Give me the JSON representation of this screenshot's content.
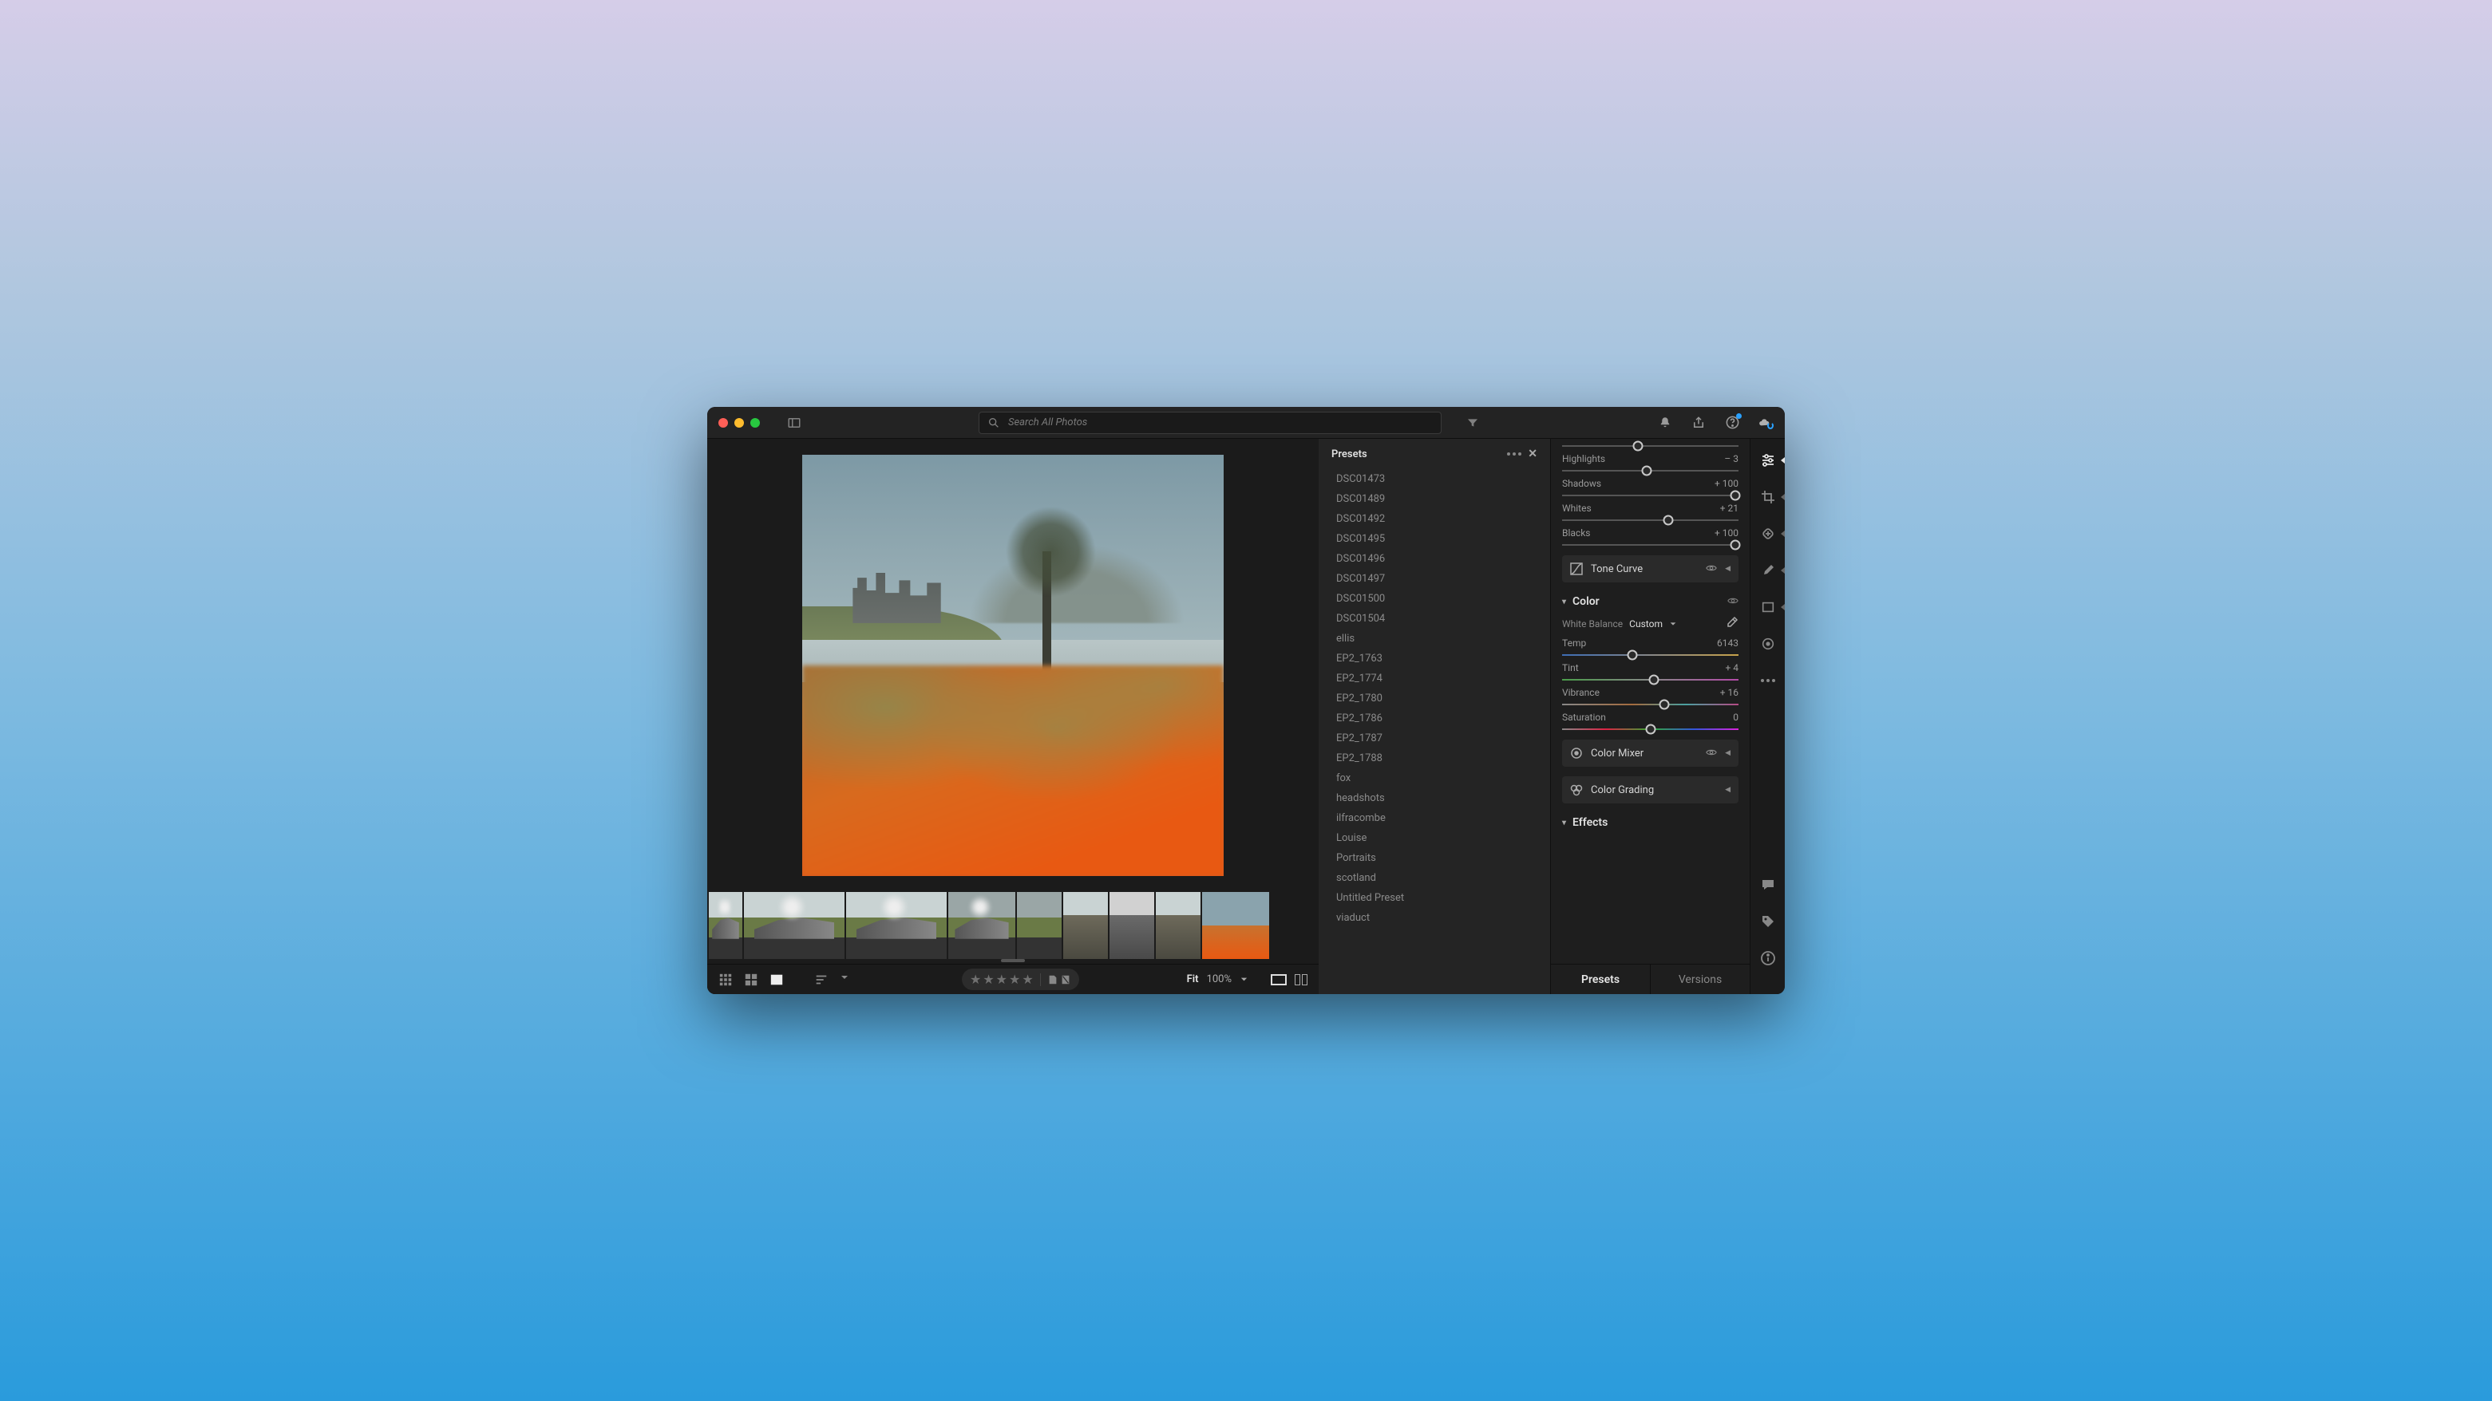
{
  "search": {
    "placeholder": "Search All Photos"
  },
  "presets": {
    "title": "Presets",
    "items": [
      "DSC01473",
      "DSC01489",
      "DSC01492",
      "DSC01495",
      "DSC01496",
      "DSC01497",
      "DSC01500",
      "DSC01504",
      "ellis",
      "EP2_1763",
      "EP2_1774",
      "EP2_1780",
      "EP2_1786",
      "EP2_1787",
      "EP2_1788",
      "fox",
      "headshots",
      "ilfracombe",
      "Louise",
      "Portraits",
      "scotland",
      "Untitled Preset",
      "viaduct"
    ]
  },
  "light": {
    "highlights": {
      "label": "Highlights",
      "value": "– 3",
      "pos": 48
    },
    "shadows": {
      "label": "Shadows",
      "value": "+ 100",
      "pos": 98
    },
    "whites": {
      "label": "Whites",
      "value": "+ 21",
      "pos": 60
    },
    "blacks": {
      "label": "Blacks",
      "value": "+ 100",
      "pos": 98
    },
    "contrast": {
      "pos": 43
    },
    "tone_curve_label": "Tone Curve"
  },
  "color": {
    "title": "Color",
    "wb_label": "White Balance",
    "wb_value": "Custom",
    "temp": {
      "label": "Temp",
      "value": "6143",
      "pos": 40
    },
    "tint": {
      "label": "Tint",
      "value": "+ 4",
      "pos": 52
    },
    "vibrance": {
      "label": "Vibrance",
      "value": "+ 16",
      "pos": 58
    },
    "saturation": {
      "label": "Saturation",
      "value": "0",
      "pos": 50
    },
    "mixer_label": "Color Mixer",
    "grading_label": "Color Grading"
  },
  "effects": {
    "title": "Effects"
  },
  "bottom": {
    "fit": "Fit",
    "zoom": "100%"
  },
  "edit_tabs": {
    "presets": "Presets",
    "versions": "Versions"
  },
  "filmstrip": {
    "selected": 8
  }
}
